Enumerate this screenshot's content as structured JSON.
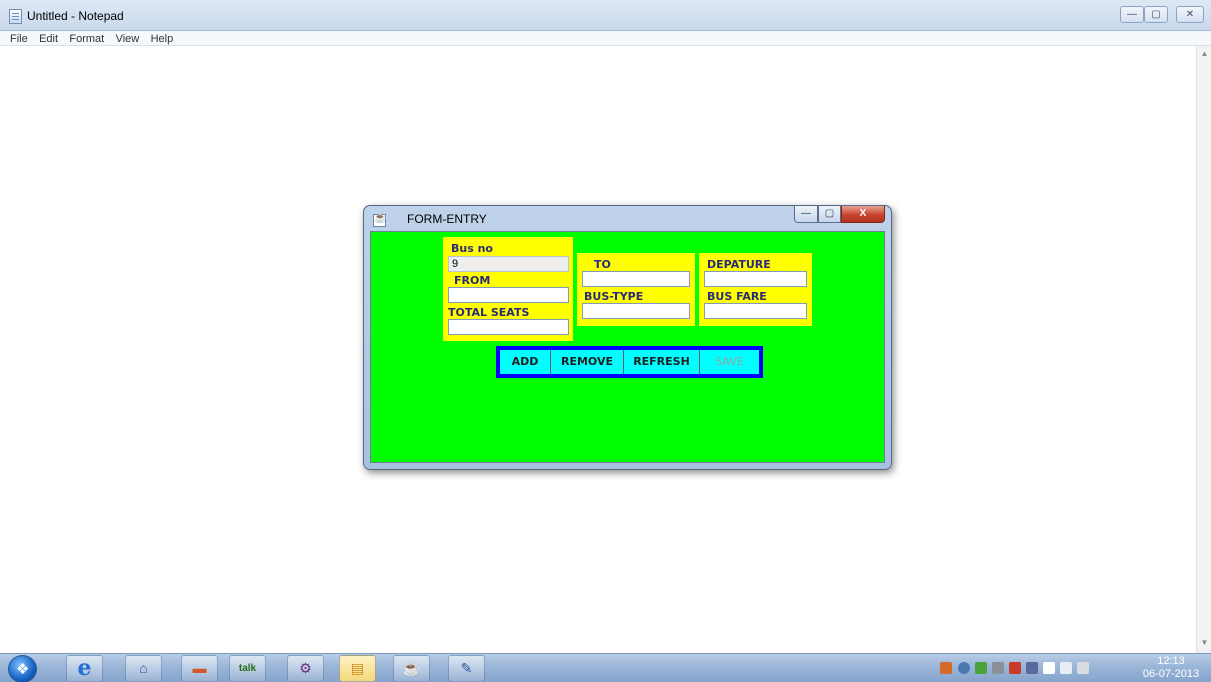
{
  "notepad": {
    "title": "Untitled - Notepad",
    "menu": [
      "File",
      "Edit",
      "Format",
      "View",
      "Help"
    ],
    "controls": {
      "minimize": "—",
      "maximize": "▢",
      "close": "✕"
    }
  },
  "dialog": {
    "title": "FORM-ENTRY",
    "controls": {
      "minimize": "—",
      "maximize": "▢",
      "close": "X"
    },
    "background_color": "#00ff00",
    "panel_color": "#ffff00",
    "fields": {
      "bus_no": {
        "label": "Bus no",
        "value": "9"
      },
      "from": {
        "label": "FROM",
        "value": ""
      },
      "total_seats": {
        "label": "TOTAL SEATS",
        "value": ""
      },
      "to": {
        "label": "TO",
        "value": ""
      },
      "bus_type": {
        "label": "BUS-TYPE",
        "value": ""
      },
      "depature": {
        "label": "DEPATURE",
        "value": ""
      },
      "bus_fare": {
        "label": "BUS FARE",
        "value": ""
      }
    },
    "buttons": {
      "add": "ADD",
      "remove": "REMOVE",
      "refresh": "REFRESH",
      "save": "SAVE"
    }
  },
  "taskbar": {
    "apps": [
      "start-orb",
      "internet-explorer",
      "hp-app",
      "media-app",
      "google-talk",
      "java-ee-ide",
      "file-explorer",
      "java-app",
      "notepad"
    ],
    "talk_label": "talk",
    "clock": {
      "time": "12:13",
      "date": "06-07-2013"
    }
  }
}
